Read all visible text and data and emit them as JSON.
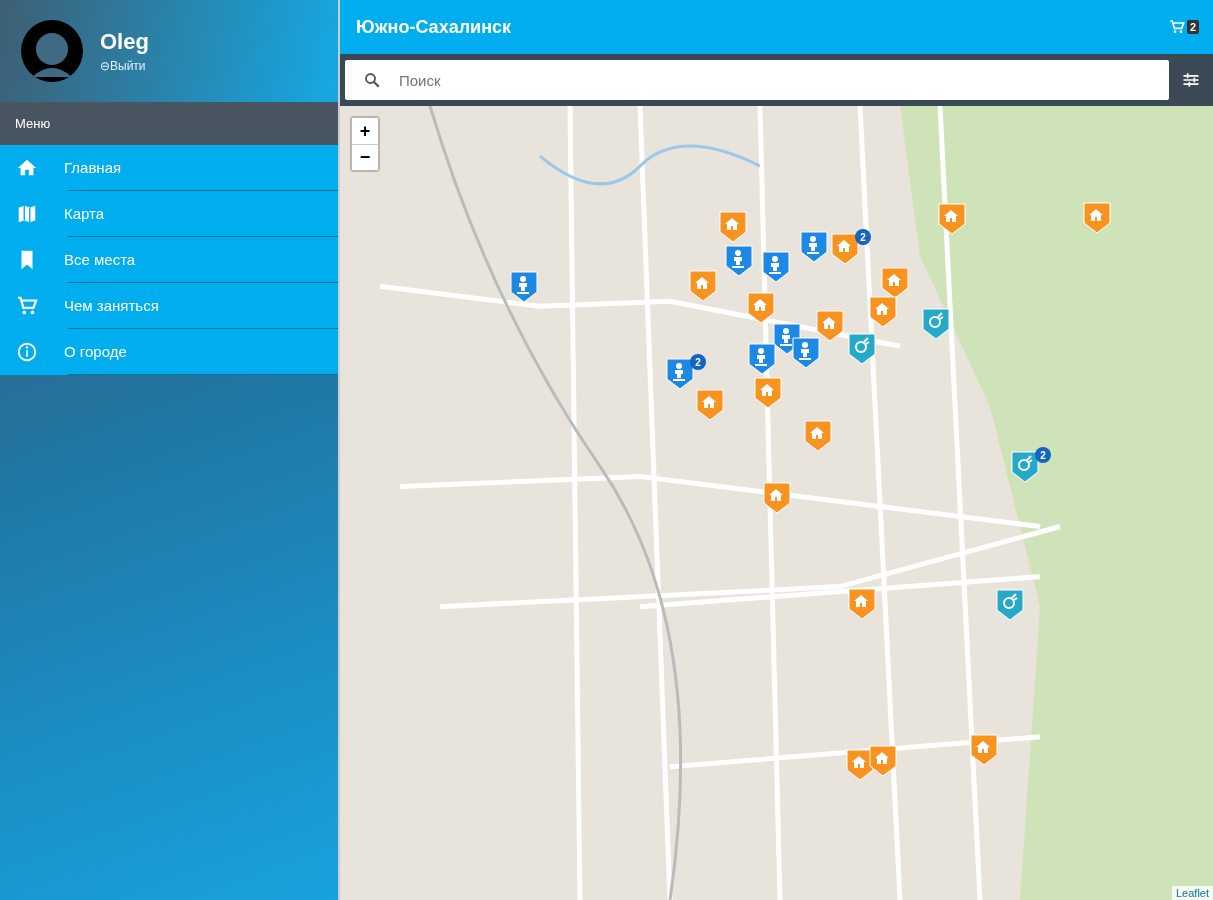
{
  "user": {
    "name": "Oleg",
    "logout": "⊖Выйти"
  },
  "menu": {
    "title": "Меню",
    "items": [
      {
        "label": "Главная",
        "kind": "home"
      },
      {
        "label": "Карта",
        "kind": "map"
      },
      {
        "label": "Все места",
        "kind": "bookmark"
      },
      {
        "label": "Чем заняться",
        "kind": "cart"
      },
      {
        "label": "О городе",
        "kind": "info"
      }
    ]
  },
  "header": {
    "title": "Южно-Сахалинск",
    "cart_count": "2"
  },
  "search": {
    "placeholder": "Поиск"
  },
  "map": {
    "zoom_in": "+",
    "zoom_out": "−",
    "attribution": "Leaflet",
    "markers": [
      {
        "kind": "home"
      },
      {
        "kind": "home"
      },
      {
        "kind": "home"
      },
      {
        "kind": "home"
      },
      {
        "kind": "home"
      },
      {
        "kind": "home"
      },
      {
        "kind": "home"
      },
      {
        "kind": "home"
      },
      {
        "kind": "home"
      },
      {
        "kind": "home"
      },
      {
        "kind": "home"
      },
      {
        "kind": "home"
      },
      {
        "kind": "home"
      },
      {
        "kind": "home"
      },
      {
        "kind": "home"
      },
      {
        "kind": "home"
      },
      {
        "kind": "home",
        "count": "2"
      },
      {
        "kind": "person"
      },
      {
        "kind": "person"
      },
      {
        "kind": "person"
      },
      {
        "kind": "person"
      },
      {
        "kind": "person"
      },
      {
        "kind": "person"
      },
      {
        "kind": "person"
      },
      {
        "kind": "person",
        "count": "2"
      },
      {
        "kind": "ball"
      },
      {
        "kind": "ball"
      },
      {
        "kind": "ball"
      },
      {
        "kind": "ball",
        "count": "2"
      }
    ]
  }
}
